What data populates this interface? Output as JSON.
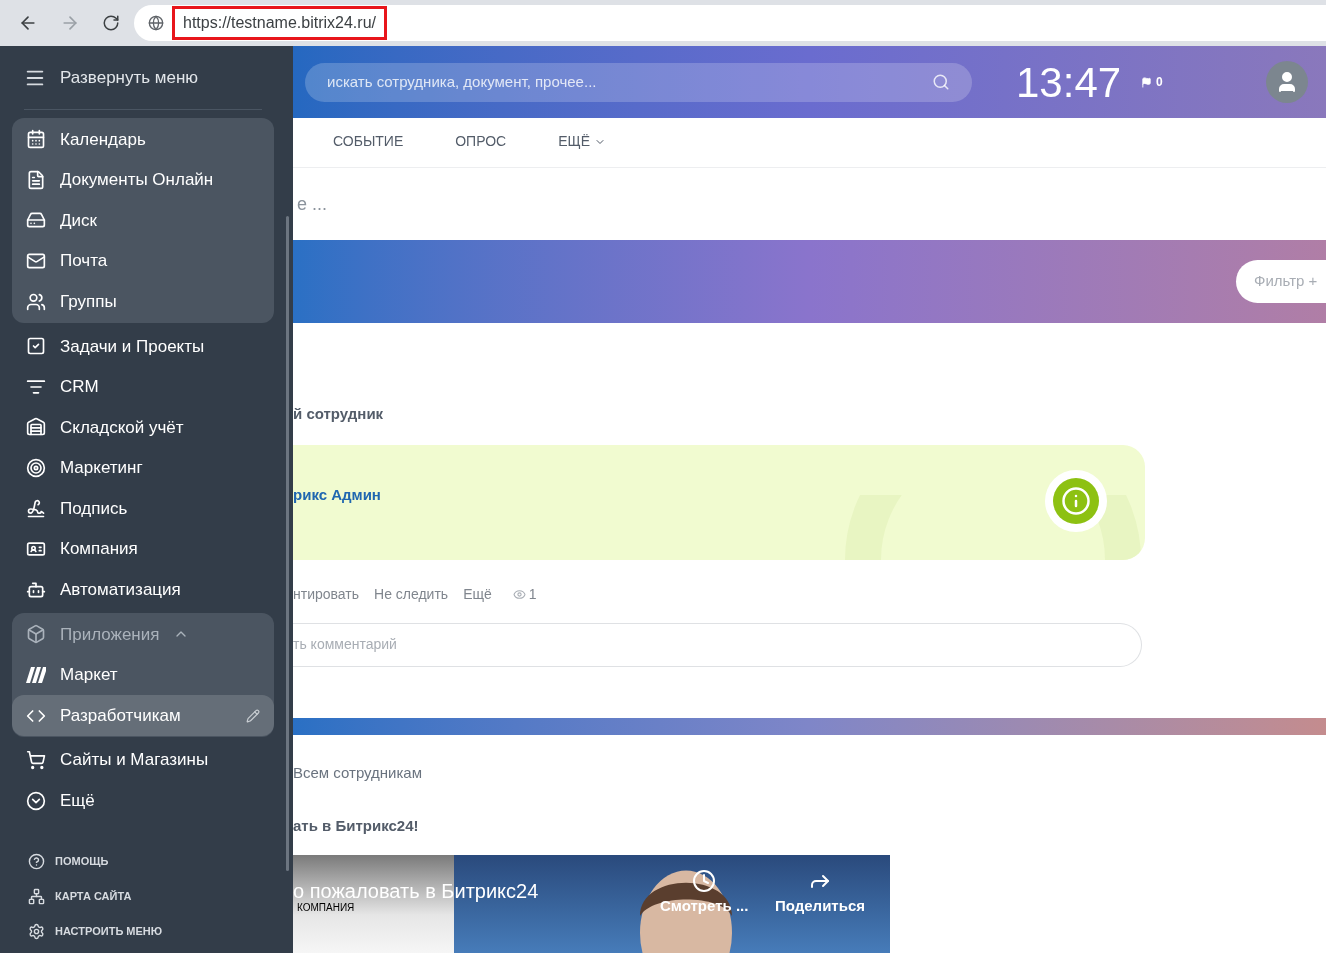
{
  "browser": {
    "url": "https://testname.bitrix24.ru/"
  },
  "header": {
    "search": {
      "placeholder": "искать сотрудника, документ, прочее..."
    },
    "time": "13:47",
    "flag_count": "0"
  },
  "sidebar": {
    "expand_label": "Развернуть меню",
    "sections": [
      {
        "highlighted": true,
        "items": [
          {
            "label": "Календарь",
            "selected": false
          },
          {
            "label": "Документы Онлайн",
            "selected": false
          },
          {
            "label": "Диск",
            "selected": false
          },
          {
            "label": "Почта",
            "selected": false
          },
          {
            "label": "Группы",
            "selected": false
          }
        ]
      },
      {
        "highlighted": false,
        "items": [
          {
            "label": "Задачи и Проекты",
            "selected": false
          },
          {
            "label": "CRM",
            "selected": false
          },
          {
            "label": "Складской учёт",
            "selected": false
          },
          {
            "label": "Маркетинг",
            "selected": false
          },
          {
            "label": "Подпись",
            "selected": false
          },
          {
            "label": "Компания",
            "selected": false
          },
          {
            "label": "Автоматизация",
            "selected": false
          }
        ]
      },
      {
        "highlighted": true,
        "items": [
          {
            "label": "Приложения",
            "selected": false,
            "expanded": true,
            "children": [
              {
                "label": "Маркет",
                "selected": false
              },
              {
                "label": "Разработчикам",
                "selected": true
              }
            ]
          }
        ]
      },
      {
        "highlighted": false,
        "items": [
          {
            "label": "Сайты и Магазины",
            "selected": false
          },
          {
            "label": "Ещё",
            "selected": false
          }
        ]
      }
    ],
    "footer": [
      "ПОМОЩЬ",
      "КАРТА САЙТА",
      "НАСТРОИТЬ МЕНЮ"
    ]
  },
  "composer": {
    "tabs": [
      {
        "label": "СОБЫТИЕ",
        "selected": false
      },
      {
        "label": "ОПРОС",
        "selected": false
      },
      {
        "label": "ЕЩЁ",
        "selected": false
      }
    ],
    "placeholder": "е ..."
  },
  "feed": {
    "filter": "Фильтр +",
    "posts": [
      {
        "kind": "new-employee",
        "title": "й сотрудник",
        "card": {
          "name": "рикс Админ"
        },
        "actions": [
          "нтировать",
          "Не следить",
          "Ещё"
        ],
        "views": "1",
        "comment_placeholder": "ть комментарий"
      },
      {
        "kind": "video",
        "recipients": "Всем сотрудникам",
        "title": "ать в Битрикс24!",
        "video": {
          "title": "о пожаловать в Битрикс24",
          "caption": "КОМПАНИЯ",
          "actions": [
            "Смотреть ...",
            "Поделиться"
          ]
        }
      }
    ]
  }
}
